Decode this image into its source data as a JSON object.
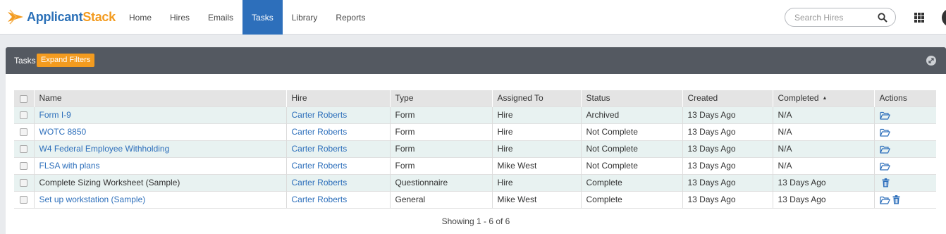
{
  "brand": {
    "name_part1": "Applicant",
    "name_part2": "Stack"
  },
  "nav": {
    "items": [
      {
        "label": "Home",
        "active": false
      },
      {
        "label": "Hires",
        "active": false
      },
      {
        "label": "Emails",
        "active": false
      },
      {
        "label": "Tasks",
        "active": true
      },
      {
        "label": "Library",
        "active": false
      },
      {
        "label": "Reports",
        "active": false
      }
    ]
  },
  "search": {
    "placeholder": "Search Hires",
    "value": ""
  },
  "panel": {
    "title": "Tasks",
    "expand_filters_label": "Expand Filters"
  },
  "table": {
    "columns": [
      "Name",
      "Hire",
      "Type",
      "Assigned To",
      "Status",
      "Created",
      "Completed",
      "Actions"
    ],
    "sorted_column": "Completed",
    "sort_direction": "ascending",
    "rows": [
      {
        "name": "Form I-9",
        "name_is_link": true,
        "hire": "Carter Roberts",
        "type": "Form",
        "assigned_to": "Hire",
        "status": "Archived",
        "created": "13 Days Ago",
        "completed": "N/A",
        "actions": [
          "folder-open-icon"
        ]
      },
      {
        "name": "WOTC 8850",
        "name_is_link": true,
        "hire": "Carter Roberts",
        "type": "Form",
        "assigned_to": "Hire",
        "status": "Not Complete",
        "created": "13 Days Ago",
        "completed": "N/A",
        "actions": [
          "folder-open-icon"
        ]
      },
      {
        "name": "W4 Federal Employee Withholding",
        "name_is_link": true,
        "hire": "Carter Roberts",
        "type": "Form",
        "assigned_to": "Hire",
        "status": "Not Complete",
        "created": "13 Days Ago",
        "completed": "N/A",
        "actions": [
          "folder-open-icon"
        ]
      },
      {
        "name": "FLSA with plans",
        "name_is_link": true,
        "hire": "Carter Roberts",
        "type": "Form",
        "assigned_to": "Mike West",
        "status": "Not Complete",
        "created": "13 Days Ago",
        "completed": "N/A",
        "actions": [
          "folder-open-icon"
        ]
      },
      {
        "name": "Complete Sizing Worksheet (Sample)",
        "name_is_link": false,
        "hire": "Carter Roberts",
        "type": "Questionnaire",
        "assigned_to": "Hire",
        "status": "Complete",
        "created": "13 Days Ago",
        "completed": "13 Days Ago",
        "actions": [
          "trash-icon"
        ]
      },
      {
        "name": "Set up workstation (Sample)",
        "name_is_link": true,
        "hire": "Carter Roberts",
        "type": "General",
        "assigned_to": "Mike West",
        "status": "Complete",
        "created": "13 Days Ago",
        "completed": "13 Days Ago",
        "actions": [
          "folder-open-icon",
          "trash-icon"
        ]
      }
    ]
  },
  "pagination": {
    "summary": "Showing 1 - 6 of 6"
  },
  "colors": {
    "brand_blue": "#2d6fbb",
    "brand_orange": "#f39b1f",
    "panel_header": "#545961",
    "row_highlight": "#e8f2f1"
  }
}
